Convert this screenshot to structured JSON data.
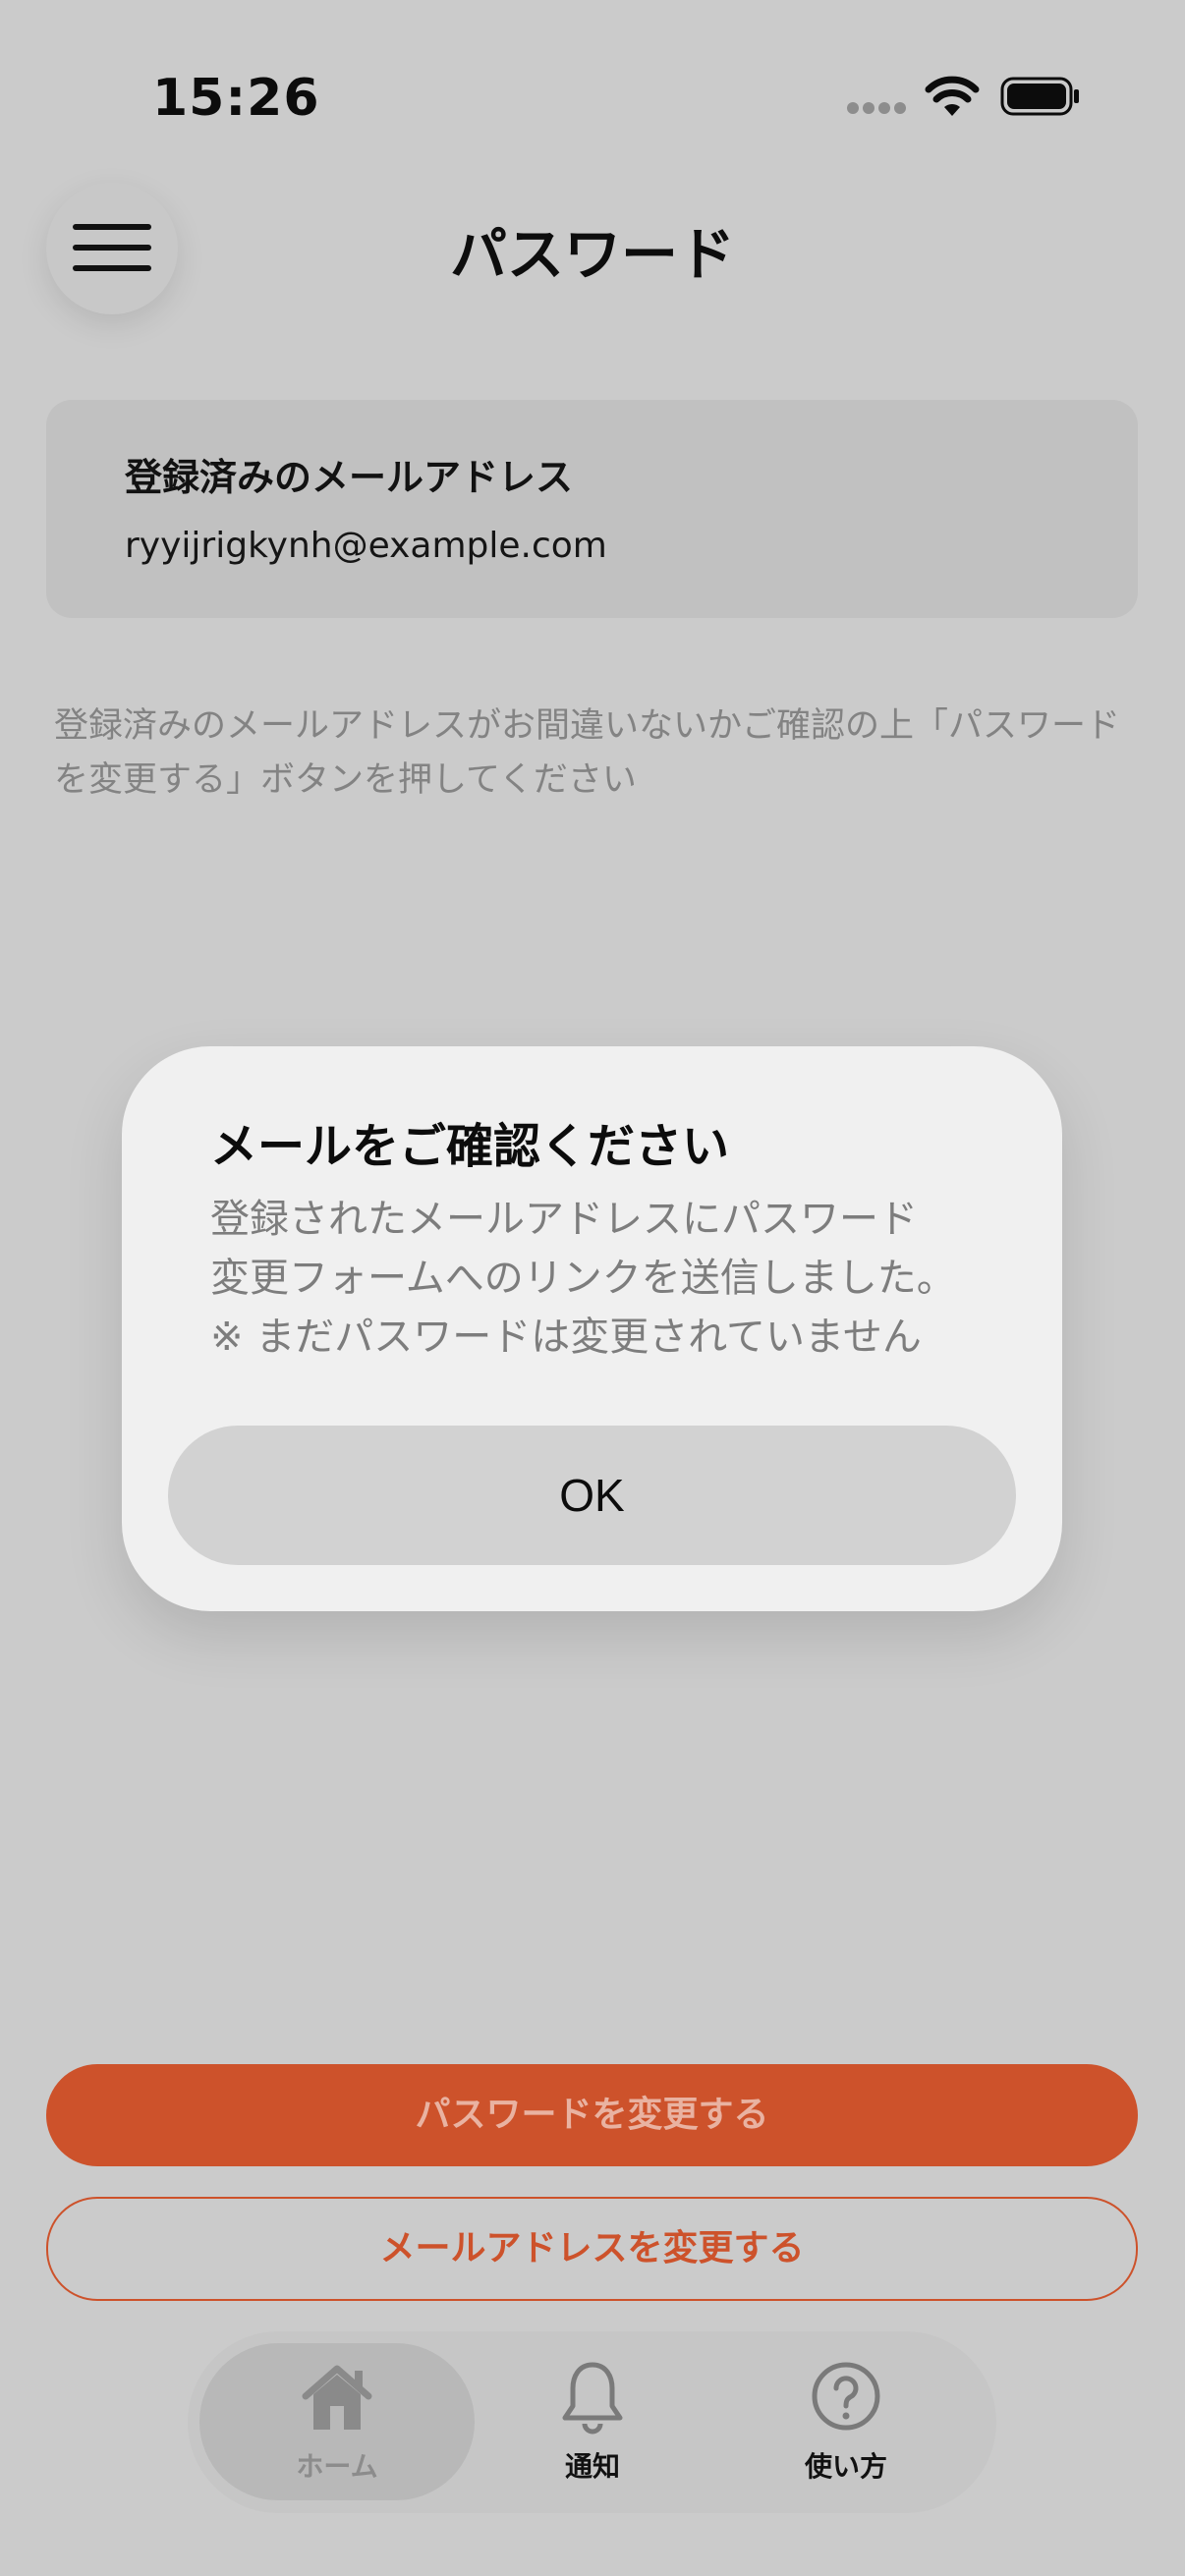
{
  "status_bar": {
    "time": "15:26"
  },
  "header": {
    "title": "パスワード",
    "menu_icon": "hamburger-icon"
  },
  "email_card": {
    "label": "登録済みのメールアドレス",
    "email": "ryyijrigkynh@example.com"
  },
  "help_text": "登録済みのメールアドレスがお間違いないかご確認の上「パスワードを変更する」ボタンを押してください",
  "modal": {
    "title": "メールをご確認ください",
    "body_lines": [
      "登録されたメールアドレスにパスワード",
      "変更フォームへのリンクを送信しました。",
      "※ まだパスワードは変更されていません"
    ],
    "ok_label": "OK"
  },
  "actions": {
    "change_password": "パスワードを変更する",
    "change_email": "メールアドレスを変更する"
  },
  "tab_bar": {
    "tabs": [
      {
        "label": "ホーム",
        "icon": "home-icon",
        "active": true
      },
      {
        "label": "通知",
        "icon": "bell-icon",
        "active": false
      },
      {
        "label": "使い方",
        "icon": "question-icon",
        "active": false
      }
    ]
  },
  "colors": {
    "accent": "#cd522b",
    "background": "#cbcbcb",
    "modal_background": "#f0f0f0"
  }
}
